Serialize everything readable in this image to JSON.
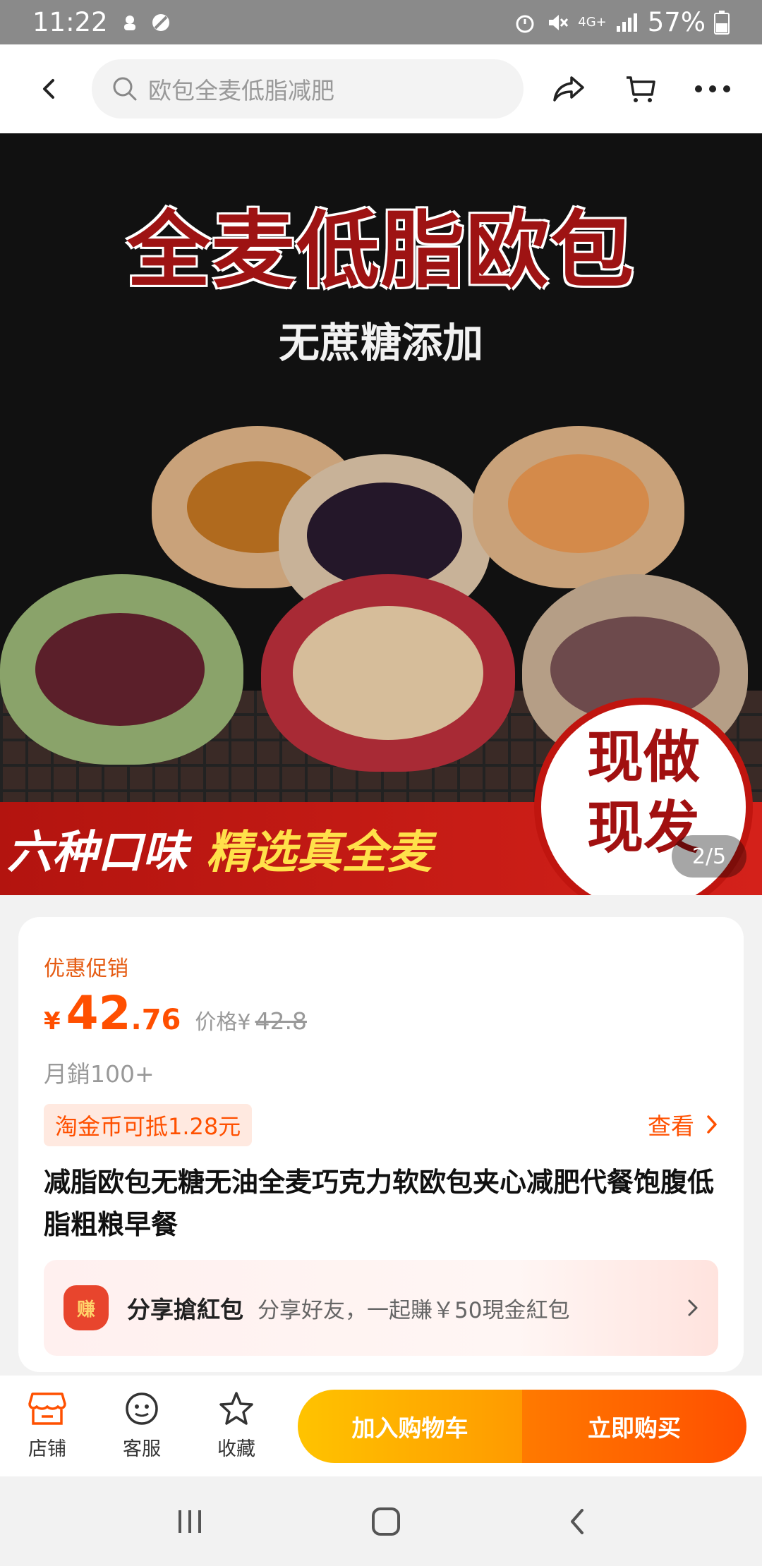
{
  "status_bar": {
    "time": "11:22",
    "network": "4G+",
    "battery": "57%"
  },
  "search": {
    "placeholder": "欧包全麦低脂减肥"
  },
  "banner": {
    "title": "全麦低脂欧包",
    "subtitle": "无蔗糖添加",
    "ribbon_left": "六种口味",
    "ribbon_right": "精选真全麦",
    "stamp_line1": "现做",
    "stamp_line2": "现发",
    "pager": "2/5"
  },
  "product": {
    "promo_label": "优惠促销",
    "currency": "¥",
    "price_int": "42",
    "price_dec": ".76",
    "orig_label": "价格",
    "orig_currency": "¥",
    "orig_price": "42.8",
    "sales": "月銷100+",
    "coin_badge": "淘金币可抵1.28元",
    "view_label": "查看",
    "title": "减脂欧包无糖无油全麦巧克力软欧包夹心减肥代餐饱腹低脂粗粮早餐"
  },
  "share": {
    "bag_text": "赚",
    "heading": "分享搶紅包",
    "desc": "分享好友，一起賺￥50現金紅包"
  },
  "bottom_tabs": [
    {
      "label": "店铺",
      "icon": "shop-icon"
    },
    {
      "label": "客服",
      "icon": "customer-service-icon"
    },
    {
      "label": "收藏",
      "icon": "star-icon"
    }
  ],
  "actions": {
    "add_cart": "加入购物车",
    "buy_now": "立即购买"
  },
  "colors": {
    "accent": "#ff5000",
    "promo": "#e55b12",
    "cart_btn": "#ffb300",
    "buy_btn": "#ff5a00"
  }
}
